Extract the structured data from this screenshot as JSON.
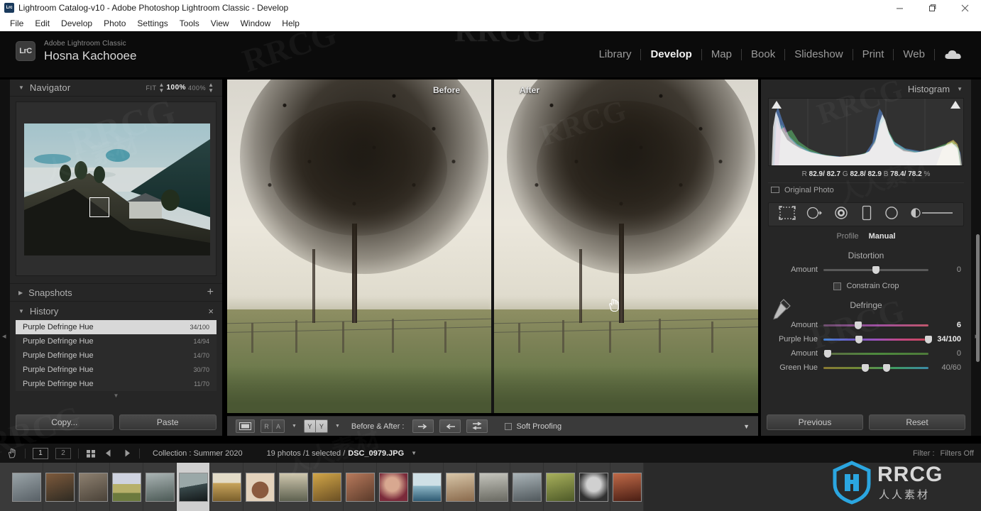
{
  "window": {
    "title": "Lightroom Catalog-v10 - Adobe Photoshop Lightroom Classic - Develop",
    "app_icon": "Lrc",
    "controls": {
      "minimize": "minimize-icon",
      "maximize": "maximize-icon",
      "close": "close-icon"
    }
  },
  "menubar": {
    "items": [
      "File",
      "Edit",
      "Develop",
      "Photo",
      "Settings",
      "Tools",
      "View",
      "Window",
      "Help"
    ]
  },
  "identity": {
    "badge": "LrC",
    "product": "Adobe Lightroom Classic",
    "user": "Hosna Kachooee"
  },
  "modules": {
    "items": [
      "Library",
      "Develop",
      "Map",
      "Book",
      "Slideshow",
      "Print",
      "Web"
    ],
    "active": "Develop",
    "cloud_icon": "cloud-icon"
  },
  "navigator": {
    "title": "Navigator",
    "fit": "FIT",
    "zoom_100": "100%",
    "zoom_400": "400%"
  },
  "snapshots": {
    "title": "Snapshots",
    "add": "+"
  },
  "history": {
    "title": "History",
    "close": "×",
    "items": [
      {
        "label": "Purple Defringe Hue",
        "value": "34/100",
        "selected": true
      },
      {
        "label": "Purple Defringe Hue",
        "value": "14/94",
        "selected": false
      },
      {
        "label": "Purple Defringe Hue",
        "value": "14/70",
        "selected": false
      },
      {
        "label": "Purple Defringe Hue",
        "value": "30/70",
        "selected": false
      },
      {
        "label": "Purple Defringe Hue",
        "value": "11/70",
        "selected": false
      }
    ]
  },
  "left_footer": {
    "copy": "Copy...",
    "paste": "Paste"
  },
  "image_view": {
    "before_label": "Before",
    "after_label": "After",
    "cursor": "hand-cursor"
  },
  "toolbar": {
    "loupe_icon": "loupe-view-icon",
    "ba_ra_left": "R",
    "ba_ra_right": "A",
    "yy_left": "Y",
    "yy_right": "Y",
    "before_after_label": "Before & After :",
    "copy_after_to_before": "arrow-right-icon",
    "copy_before_to_after": "arrow-left-icon",
    "swap_before_after": "swap-icon",
    "soft_proofing_label": "Soft Proofing",
    "soft_proofing_checked": false,
    "more_caret": "chevron-down-icon"
  },
  "histogram": {
    "title": "Histogram",
    "collapse_icon": "chevron-down-icon",
    "shadow_clip_icon": "shadow-clipping-icon",
    "highlight_clip_icon": "highlight-clipping-icon",
    "readout": {
      "r_label": "R",
      "r": "82.9/ 82.7",
      "g_label": "G",
      "g": "82.8/ 82.9",
      "b_label": "B",
      "b": "78.4/ 78.2",
      "unit": "%"
    },
    "original_photo": "Original Photo"
  },
  "toolstrip": {
    "tools": [
      "crop-overlay-icon",
      "spot-removal-icon",
      "red-eye-icon",
      "graduated-filter-icon",
      "radial-filter-icon",
      "adjustment-brush-icon"
    ]
  },
  "lens_panel": {
    "profile_label": "Profile",
    "manual_label": "Manual",
    "distortion_title": "Distortion",
    "distortion_amount_label": "Amount",
    "distortion_amount_value": "0",
    "constrain_crop_label": "Constrain Crop",
    "constrain_crop_checked": false,
    "defringe_title": "Defringe",
    "eyedropper_icon": "eyedropper-icon",
    "purple_amount_label": "Amount",
    "purple_amount_value": "6",
    "purple_hue_label": "Purple Hue",
    "purple_hue_value": "34/100",
    "green_amount_label": "Amount",
    "green_amount_value": "0",
    "green_hue_label": "Green Hue",
    "green_hue_value": "40/60"
  },
  "right_footer": {
    "previous": "Previous",
    "reset": "Reset"
  },
  "filmstrip_bar": {
    "grid_icon": "grid-view-icon",
    "back_icon": "arrow-left-icon",
    "forward_icon": "arrow-right-icon",
    "page1": "1",
    "page2": "2",
    "collection": "Collection : Summer 2020",
    "photo_count": "19 photos /1 selected /",
    "filename": "DSC_0979.JPG",
    "filename_caret": "chevron-down-icon",
    "filter_label": "Filter :",
    "filter_value": "Filters Off"
  },
  "filmstrip": {
    "selected_index": 5,
    "thumbnails": [
      {
        "name": "thumb-foggy-field",
        "c1": "#9aa4a8",
        "c2": "#586066"
      },
      {
        "name": "thumb-red-figure",
        "c1": "#7d5a3c",
        "c2": "#2e2a22"
      },
      {
        "name": "thumb-stone-house",
        "c1": "#8d8070",
        "c2": "#4a4238"
      },
      {
        "name": "thumb-green-field",
        "c1": "#b7b06a",
        "c2": "#6c7a3e"
      },
      {
        "name": "thumb-mountain-mist",
        "c1": "#aab4b4",
        "c2": "#4c5a56"
      },
      {
        "name": "thumb-hill-house",
        "c1": "#7f8f90",
        "c2": "#20282a"
      },
      {
        "name": "thumb-golden-field",
        "c1": "#c8a45c",
        "c2": "#7a5f2c"
      },
      {
        "name": "thumb-portrait-warm",
        "c1": "#e3d2bc",
        "c2": "#8a5a3e"
      },
      {
        "name": "thumb-reeds-water",
        "c1": "#cfc7ae",
        "c2": "#5e6150"
      },
      {
        "name": "thumb-yellow-tree",
        "c1": "#d2a648",
        "c2": "#6a4f24"
      },
      {
        "name": "thumb-autumn-bride",
        "c1": "#b87a5c",
        "c2": "#5a3a2a"
      },
      {
        "name": "thumb-woman-red",
        "c1": "#d8a890",
        "c2": "#7a2a3a"
      },
      {
        "name": "thumb-blue-sea",
        "c1": "#8fb8c8",
        "c2": "#2e5a72"
      },
      {
        "name": "thumb-beach-couple",
        "c1": "#d8c6a8",
        "c2": "#8a6a4c"
      },
      {
        "name": "thumb-city-haze",
        "c1": "#c4c4bc",
        "c2": "#6a6a62"
      },
      {
        "name": "thumb-town-view",
        "c1": "#aab4b8",
        "c2": "#50585c"
      },
      {
        "name": "thumb-green-grass",
        "c1": "#a8b05c",
        "c2": "#4e5a28"
      },
      {
        "name": "thumb-bw-portrait",
        "c1": "#d0d0d0",
        "c2": "#303030"
      },
      {
        "name": "thumb-red-portrait",
        "c1": "#c06a48",
        "c2": "#4a1e14"
      }
    ]
  },
  "watermarks": {
    "primary": "RRCG",
    "chinese": "人人素材",
    "logo": "rrcg-logo"
  }
}
